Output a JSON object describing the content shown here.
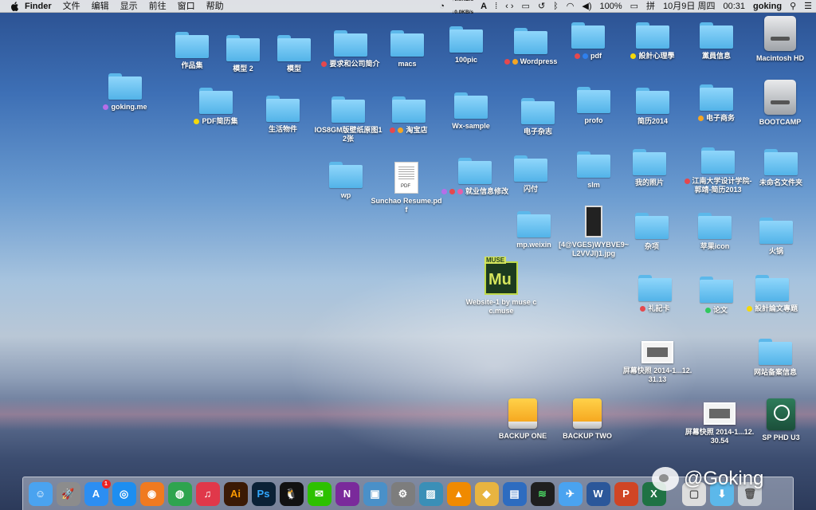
{
  "menubar": {
    "apple": "apple-icon",
    "app": "Finder",
    "items": [
      "文件",
      "编辑",
      "显示",
      "前往",
      "窗口",
      "帮助"
    ],
    "net_up": "↑0.0KB/s",
    "net_down": "↓0.0KB/s",
    "battery": "100%",
    "input_method": "拼",
    "date": "10月9日 周四",
    "time": "00:31",
    "user": "goking"
  },
  "desktop": {
    "tag_colors": {
      "red": "#e5484d",
      "orange": "#f5a623",
      "yellow": "#f5d90a",
      "green": "#30c85e",
      "blue": "#2f80ed",
      "purple": "#b66ee8",
      "pink": "#e85ea8"
    },
    "icons": [
      {
        "label": "作品集",
        "type": "folder"
      },
      {
        "label": "模型 2",
        "type": "folder"
      },
      {
        "label": "模型",
        "type": "folder"
      },
      {
        "label": "要求和公司简介",
        "type": "folder",
        "tags": [
          "red"
        ]
      },
      {
        "label": "macs",
        "type": "folder"
      },
      {
        "label": "100pic",
        "type": "folder"
      },
      {
        "label": "Wordpress",
        "type": "folder",
        "tags": [
          "red",
          "orange"
        ]
      },
      {
        "label": "pdf",
        "type": "folder",
        "tags": [
          "red",
          "blue"
        ]
      },
      {
        "label": "設計心理學",
        "type": "folder",
        "tags": [
          "yellow"
        ]
      },
      {
        "label": "黨員信息",
        "type": "folder"
      },
      {
        "label": "Macintosh HD",
        "type": "hd"
      },
      {
        "label": "goking.me",
        "type": "folder",
        "tags": [
          "purple"
        ]
      },
      {
        "label": "PDF简历集",
        "type": "folder",
        "tags": [
          "yellow"
        ]
      },
      {
        "label": "生活物件",
        "type": "folder"
      },
      {
        "label": "IOS8GM版壁纸原图12张",
        "type": "folder"
      },
      {
        "label": "淘宝店",
        "type": "folder",
        "tags": [
          "red",
          "orange"
        ]
      },
      {
        "label": "Wx-sample",
        "type": "folder"
      },
      {
        "label": "电子杂志",
        "type": "folder"
      },
      {
        "label": "profo",
        "type": "folder"
      },
      {
        "label": "简历2014",
        "type": "folder"
      },
      {
        "label": "电子商务",
        "type": "folder",
        "tags": [
          "orange"
        ]
      },
      {
        "label": "BOOTCAMP",
        "type": "hd"
      },
      {
        "label": "wp",
        "type": "folder"
      },
      {
        "label": "Sunchao Resume.pdf",
        "type": "pdf"
      },
      {
        "label": "就业信息修改",
        "type": "folder",
        "tags": [
          "purple",
          "red",
          "pink"
        ]
      },
      {
        "label": "闪付",
        "type": "folder"
      },
      {
        "label": "slm",
        "type": "folder"
      },
      {
        "label": "我的照片",
        "type": "folder"
      },
      {
        "label": "江南大学设计学院-郭靖-简历2013",
        "type": "folder",
        "tags": [
          "red"
        ]
      },
      {
        "label": "未命名文件夹",
        "type": "folder"
      },
      {
        "label": "mp.weixin",
        "type": "folder"
      },
      {
        "label": "[4@VGES)WYBVE9~L2VVJI)1.jpg",
        "type": "photo"
      },
      {
        "label": "杂项",
        "type": "folder"
      },
      {
        "label": "苹果icon",
        "type": "folder"
      },
      {
        "label": "火锅",
        "type": "folder"
      },
      {
        "label": "Website-1 by muse cc.muse",
        "type": "muse",
        "badge": "MUSE",
        "glyph": "Mu"
      },
      {
        "label": "礼記卡",
        "type": "folder",
        "tags": [
          "red"
        ]
      },
      {
        "label": "论文",
        "type": "folder",
        "tags": [
          "green"
        ]
      },
      {
        "label": "設計論文專題",
        "type": "folder",
        "tags": [
          "yellow"
        ]
      },
      {
        "label": "屏幕快照 2014-1...12.31.13",
        "type": "shot"
      },
      {
        "label": "网站备案信息",
        "type": "folder"
      },
      {
        "label": "BACKUP ONE",
        "type": "ext"
      },
      {
        "label": "BACKUP TWO",
        "type": "ext"
      },
      {
        "label": "屏幕快照 2014-1...12.30.54",
        "type": "shot"
      },
      {
        "label": "SP PHD U3",
        "type": "tm"
      }
    ]
  },
  "dock": {
    "items": [
      {
        "name": "finder-icon",
        "color": "#4aa3f0",
        "glyph": "☺"
      },
      {
        "name": "launchpad-icon",
        "color": "#8c8c8c",
        "glyph": "🚀"
      },
      {
        "name": "app-store-icon",
        "color": "#2c8ef2",
        "glyph": "A",
        "badge": "1"
      },
      {
        "name": "safari-icon",
        "color": "#1d8ef0",
        "glyph": "◎"
      },
      {
        "name": "firefox-icon",
        "color": "#f07a20",
        "glyph": "◉"
      },
      {
        "name": "chrome-icon",
        "color": "#2ea44f",
        "glyph": "◍"
      },
      {
        "name": "itunes-icon",
        "color": "#e0384a",
        "glyph": "♫"
      },
      {
        "name": "illustrator-icon",
        "color": "#3b1a05",
        "glyph": "Ai",
        "text_color": "#ff9a00"
      },
      {
        "name": "photoshop-icon",
        "color": "#0b2136",
        "glyph": "Ps",
        "text_color": "#31a8ff"
      },
      {
        "name": "qq-icon",
        "color": "#111111",
        "glyph": "🐧"
      },
      {
        "name": "wechat-icon",
        "color": "#2dc100",
        "glyph": "✉"
      },
      {
        "name": "onenote-icon",
        "color": "#7a2a9b",
        "glyph": "N"
      },
      {
        "name": "preview-icon",
        "color": "#4a90c8",
        "glyph": "▣"
      },
      {
        "name": "system-preferences-icon",
        "color": "#7d7d7d",
        "glyph": "⚙"
      },
      {
        "name": "photo-icon",
        "color": "#3a8fb7",
        "glyph": "▨"
      },
      {
        "name": "vlc-icon",
        "color": "#f08a00",
        "glyph": "▲"
      },
      {
        "name": "sketch-icon",
        "color": "#e8b440",
        "glyph": "◆"
      },
      {
        "name": "keynote-icon",
        "color": "#2d6cc0",
        "glyph": "▤"
      },
      {
        "name": "activity-monitor-icon",
        "color": "#1f1f1f",
        "glyph": "≋",
        "text_color": "#4cd964"
      },
      {
        "name": "airmail-icon",
        "color": "#4aa3f0",
        "glyph": "✈"
      },
      {
        "name": "word-icon",
        "color": "#2b579a",
        "glyph": "W"
      },
      {
        "name": "powerpoint-icon",
        "color": "#d04525",
        "glyph": "P"
      },
      {
        "name": "excel-icon",
        "color": "#1f7244",
        "glyph": "X"
      },
      {
        "name": "documents-stack-icon",
        "color": "#dddddd",
        "glyph": "▢",
        "text_color": "#555"
      },
      {
        "name": "downloads-stack-icon",
        "color": "#5cb8ea",
        "glyph": "⬇"
      },
      {
        "name": "trash-icon",
        "color": "#c8cdd3",
        "glyph": "🗑",
        "text_color": "#555"
      }
    ]
  },
  "watermark": {
    "text": "@Goking"
  }
}
